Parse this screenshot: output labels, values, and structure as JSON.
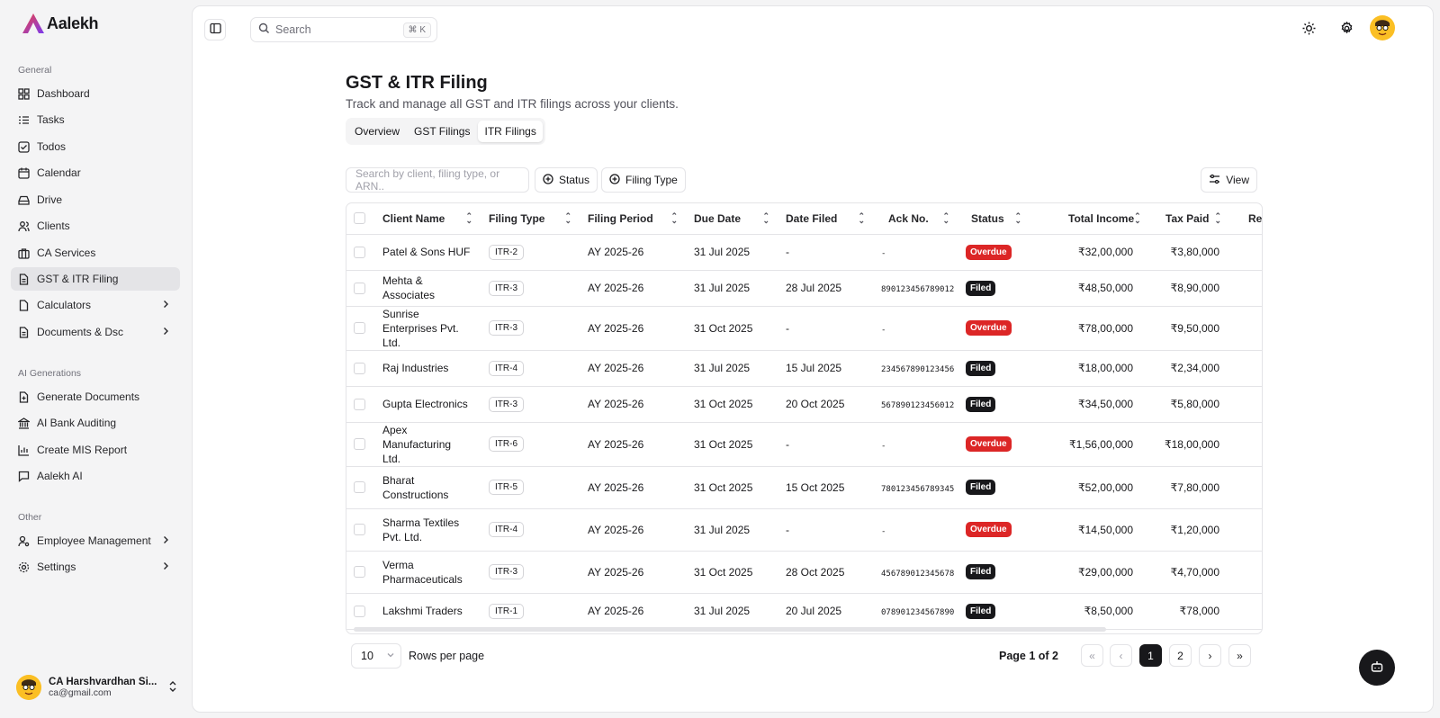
{
  "app": {
    "name": "Aalekh"
  },
  "sidebar": {
    "groups": [
      {
        "label": "General"
      },
      {
        "label": "AI Generations"
      },
      {
        "label": "Other"
      }
    ],
    "items": [
      {
        "label": "Dashboard",
        "icon": "dashboard-icon"
      },
      {
        "label": "Tasks",
        "icon": "list-icon"
      },
      {
        "label": "Todos",
        "icon": "checkbox-icon"
      },
      {
        "label": "Calendar",
        "icon": "calendar-icon"
      },
      {
        "label": "Drive",
        "icon": "drive-icon"
      },
      {
        "label": "Clients",
        "icon": "users-icon"
      },
      {
        "label": "CA Services",
        "icon": "briefcase-icon"
      },
      {
        "label": "GST & ITR Filing",
        "icon": "document-icon",
        "active": true
      },
      {
        "label": "Calculators",
        "icon": "calculator-icon"
      },
      {
        "label": "Documents & Dsc",
        "icon": "file-icon"
      },
      {
        "label": "Generate Documents",
        "icon": "file-plus-icon"
      },
      {
        "label": "AI Bank Auditing",
        "icon": "bank-icon"
      },
      {
        "label": "Create MIS Report",
        "icon": "chart-icon"
      },
      {
        "label": "Aalekh AI",
        "icon": "chat-icon"
      },
      {
        "label": "Employee Management",
        "icon": "user-cog-icon"
      },
      {
        "label": "Settings",
        "icon": "gear-icon"
      }
    ],
    "user": {
      "name": "CA Harshvardhan Si...",
      "email": "ca@gmail.com"
    }
  },
  "header": {
    "search_placeholder": "Search",
    "search_shortcut": "⌘ K"
  },
  "page": {
    "title": "GST & ITR Filing",
    "subtitle": "Track and manage all GST and ITR filings across your clients.",
    "tabs": [
      {
        "label": "Overview"
      },
      {
        "label": "GST Filings"
      },
      {
        "label": "ITR Filings",
        "active": true
      }
    ]
  },
  "filters": {
    "search_placeholder": "Search by client, filing type, or ARN..",
    "status_label": "Status",
    "filing_type_label": "Filing Type",
    "view_label": "View"
  },
  "table": {
    "columns": [
      "Client Name",
      "Filing Type",
      "Filing Period",
      "Due Date",
      "Date Filed",
      "Ack No.",
      "Status",
      "Total Income",
      "Tax Paid",
      "Refur"
    ],
    "rows": [
      {
        "client": "Patel & Sons HUF",
        "type": "ITR-2",
        "period": "AY 2025-26",
        "due": "31 Jul 2025",
        "filed": "-",
        "ack": "-",
        "status": "Overdue",
        "income": "₹32,00,000",
        "tax": "₹3,80,000"
      },
      {
        "client": "Mehta & Associates",
        "type": "ITR-3",
        "period": "AY 2025-26",
        "due": "31 Jul 2025",
        "filed": "28 Jul 2025",
        "ack": "890123456789012",
        "status": "Filed",
        "income": "₹48,50,000",
        "tax": "₹8,90,000"
      },
      {
        "client": "Sunrise Enterprises Pvt. Ltd.",
        "type": "ITR-3",
        "period": "AY 2025-26",
        "due": "31 Oct 2025",
        "filed": "-",
        "ack": "-",
        "status": "Overdue",
        "income": "₹78,00,000",
        "tax": "₹9,50,000"
      },
      {
        "client": "Raj Industries",
        "type": "ITR-4",
        "period": "AY 2025-26",
        "due": "31 Jul 2025",
        "filed": "15 Jul 2025",
        "ack": "234567890123456",
        "status": "Filed",
        "income": "₹18,00,000",
        "tax": "₹2,34,000"
      },
      {
        "client": "Gupta Electronics",
        "type": "ITR-3",
        "period": "AY 2025-26",
        "due": "31 Oct 2025",
        "filed": "20 Oct 2025",
        "ack": "567890123456012",
        "status": "Filed",
        "income": "₹34,50,000",
        "tax": "₹5,80,000"
      },
      {
        "client": "Apex Manufacturing Ltd.",
        "type": "ITR-6",
        "period": "AY 2025-26",
        "due": "31 Oct 2025",
        "filed": "-",
        "ack": "-",
        "status": "Overdue",
        "income": "₹1,56,00,000",
        "tax": "₹18,00,000"
      },
      {
        "client": "Bharat Constructions",
        "type": "ITR-5",
        "period": "AY 2025-26",
        "due": "31 Oct 2025",
        "filed": "15 Oct 2025",
        "ack": "780123456789345",
        "status": "Filed",
        "income": "₹52,00,000",
        "tax": "₹7,80,000"
      },
      {
        "client": "Sharma Textiles Pvt. Ltd.",
        "type": "ITR-4",
        "period": "AY 2025-26",
        "due": "31 Jul 2025",
        "filed": "-",
        "ack": "-",
        "status": "Overdue",
        "income": "₹14,50,000",
        "tax": "₹1,20,000"
      },
      {
        "client": "Verma Pharmaceuticals",
        "type": "ITR-3",
        "period": "AY 2025-26",
        "due": "31 Oct 2025",
        "filed": "28 Oct 2025",
        "ack": "456789012345678",
        "status": "Filed",
        "income": "₹29,00,000",
        "tax": "₹4,70,000"
      },
      {
        "client": "Lakshmi Traders",
        "type": "ITR-1",
        "period": "AY 2025-26",
        "due": "31 Jul 2025",
        "filed": "20 Jul 2025",
        "ack": "078901234567890",
        "status": "Filed",
        "income": "₹8,50,000",
        "tax": "₹78,000"
      }
    ]
  },
  "pagination": {
    "rows_per_page": "10",
    "rows_label": "Rows per page",
    "page_info": "Page 1 of 2",
    "pages": [
      "1",
      "2"
    ]
  },
  "colors": {
    "overdue": "#dc2626",
    "filed": "#18181b",
    "accent": "#18181b"
  }
}
